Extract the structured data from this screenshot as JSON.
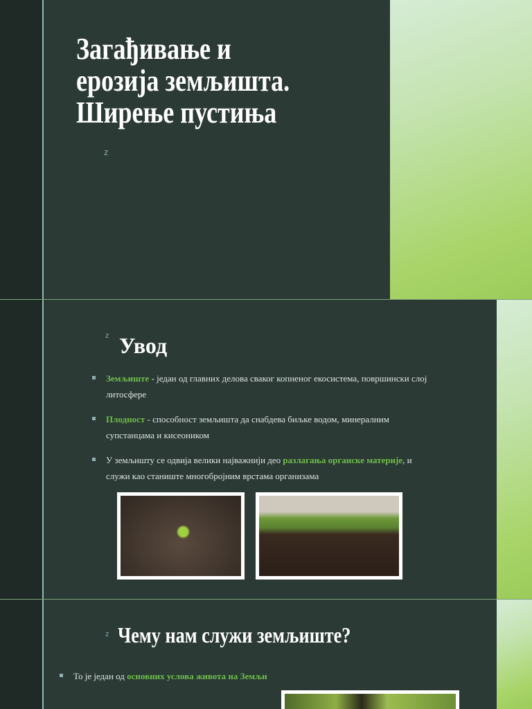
{
  "slide1": {
    "title_lines": [
      "Загађивање и",
      "ерозија земљишта.",
      "Ширење пустиња"
    ],
    "marker": "z"
  },
  "slide2": {
    "marker": "z",
    "heading": "Увод",
    "bullets": [
      {
        "term": "Земљиште",
        "text": " - један од главних делова сваког копненог екосистема, површински слој литосфере"
      },
      {
        "term": "Плодност",
        "text": " - способност земљишта да снабдева биљке водом, минералним супстанцама и кисеоником"
      },
      {
        "pre": "У земљишту се одвија велики најважнији део ",
        "term": "разлагања органске материје",
        "text": ", и служи као станиште многобројним врстама организама"
      }
    ]
  },
  "slide3": {
    "marker": "z",
    "heading": "Чему нам служи земљиште?",
    "bullets": [
      {
        "pre": "То је један од ",
        "term": "основних услова живота на Земљи"
      }
    ]
  },
  "colors": {
    "background": "#2b3a35",
    "accent": "#6fbf4a",
    "line": "#8fb8b8"
  }
}
